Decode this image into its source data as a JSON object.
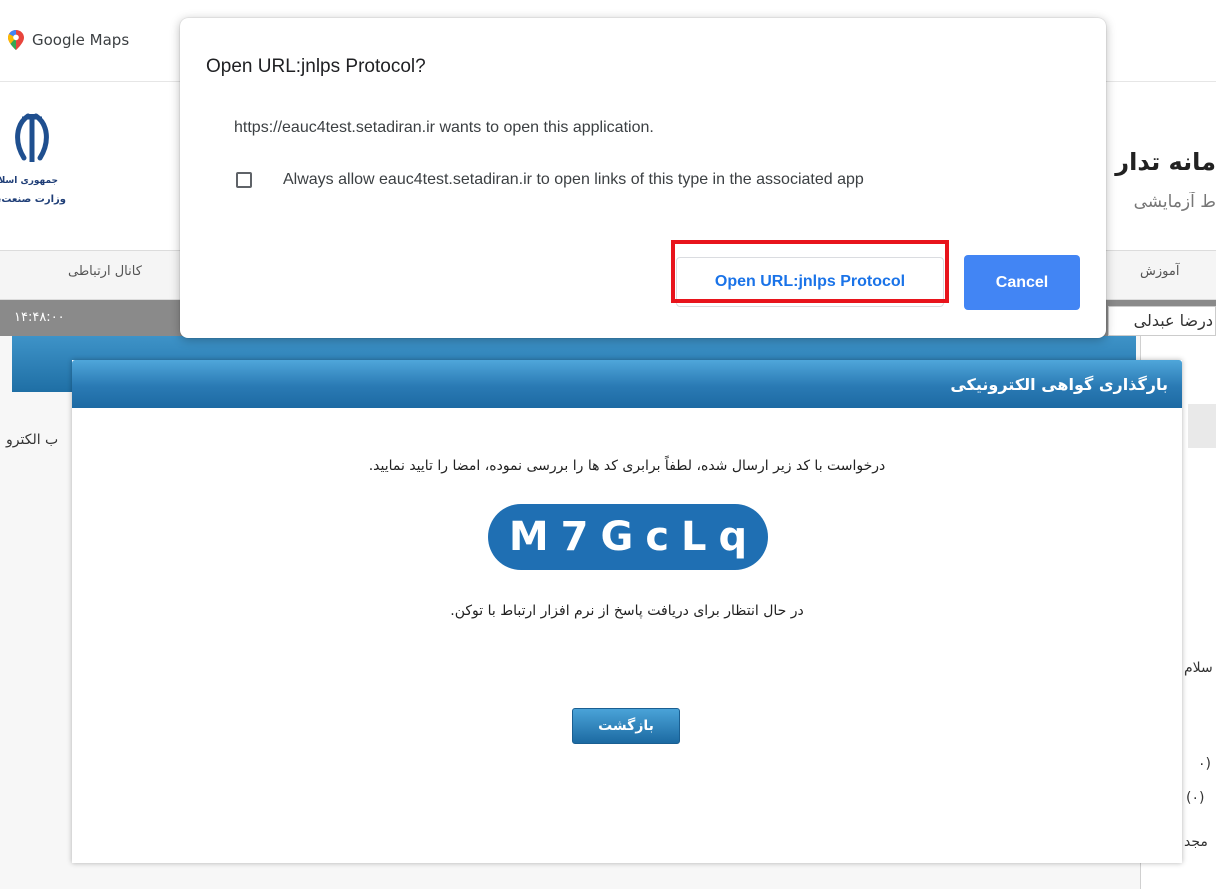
{
  "browser": {
    "bookmark_label": "Google Maps"
  },
  "site": {
    "title": "مانه تدار",
    "subtitle": "ط آزمایشی",
    "ministry_line1": "جمهوری اسلا",
    "ministry_line2": "وزارت صنعت، م",
    "nav_left": "کانال ارتباطی",
    "nav_right": "آموزش",
    "clock": "۱۴:۴۸:۰۰",
    "user": "درضا عبدلی",
    "side_fragment": "ب الکترو",
    "right_fragments": [
      "سلام",
      "(۰",
      "(۰)",
      "مجد"
    ]
  },
  "dialog": {
    "title": "بارگذاری گواهی الکترونیکی",
    "message": "درخواست با کد زیر ارسال شده، لطفاً برابری کد ها را بررسی نموده، امضا را تایید نمایید.",
    "code": "M7GcLq",
    "waiting": "در حال انتظار برای دریافت پاسخ از نرم افزار ارتباط با توکن.",
    "back_label": "بازگشت"
  },
  "prompt": {
    "title": "Open URL:jnlps Protocol?",
    "description": "https://eauc4test.setadiran.ir wants to open this application.",
    "checkbox_label": "Always allow eauc4test.setadiran.ir to open links of this type in the associated app",
    "checkbox_checked": false,
    "open_label": "Open URL:jnlps Protocol",
    "cancel_label": "Cancel"
  },
  "colors": {
    "dialog_header": "#2a7ab4",
    "code_badge": "#1f6fb3",
    "cancel_button": "#4285f4",
    "open_button_text": "#1a73e8",
    "highlight_box": "#e8141c"
  }
}
